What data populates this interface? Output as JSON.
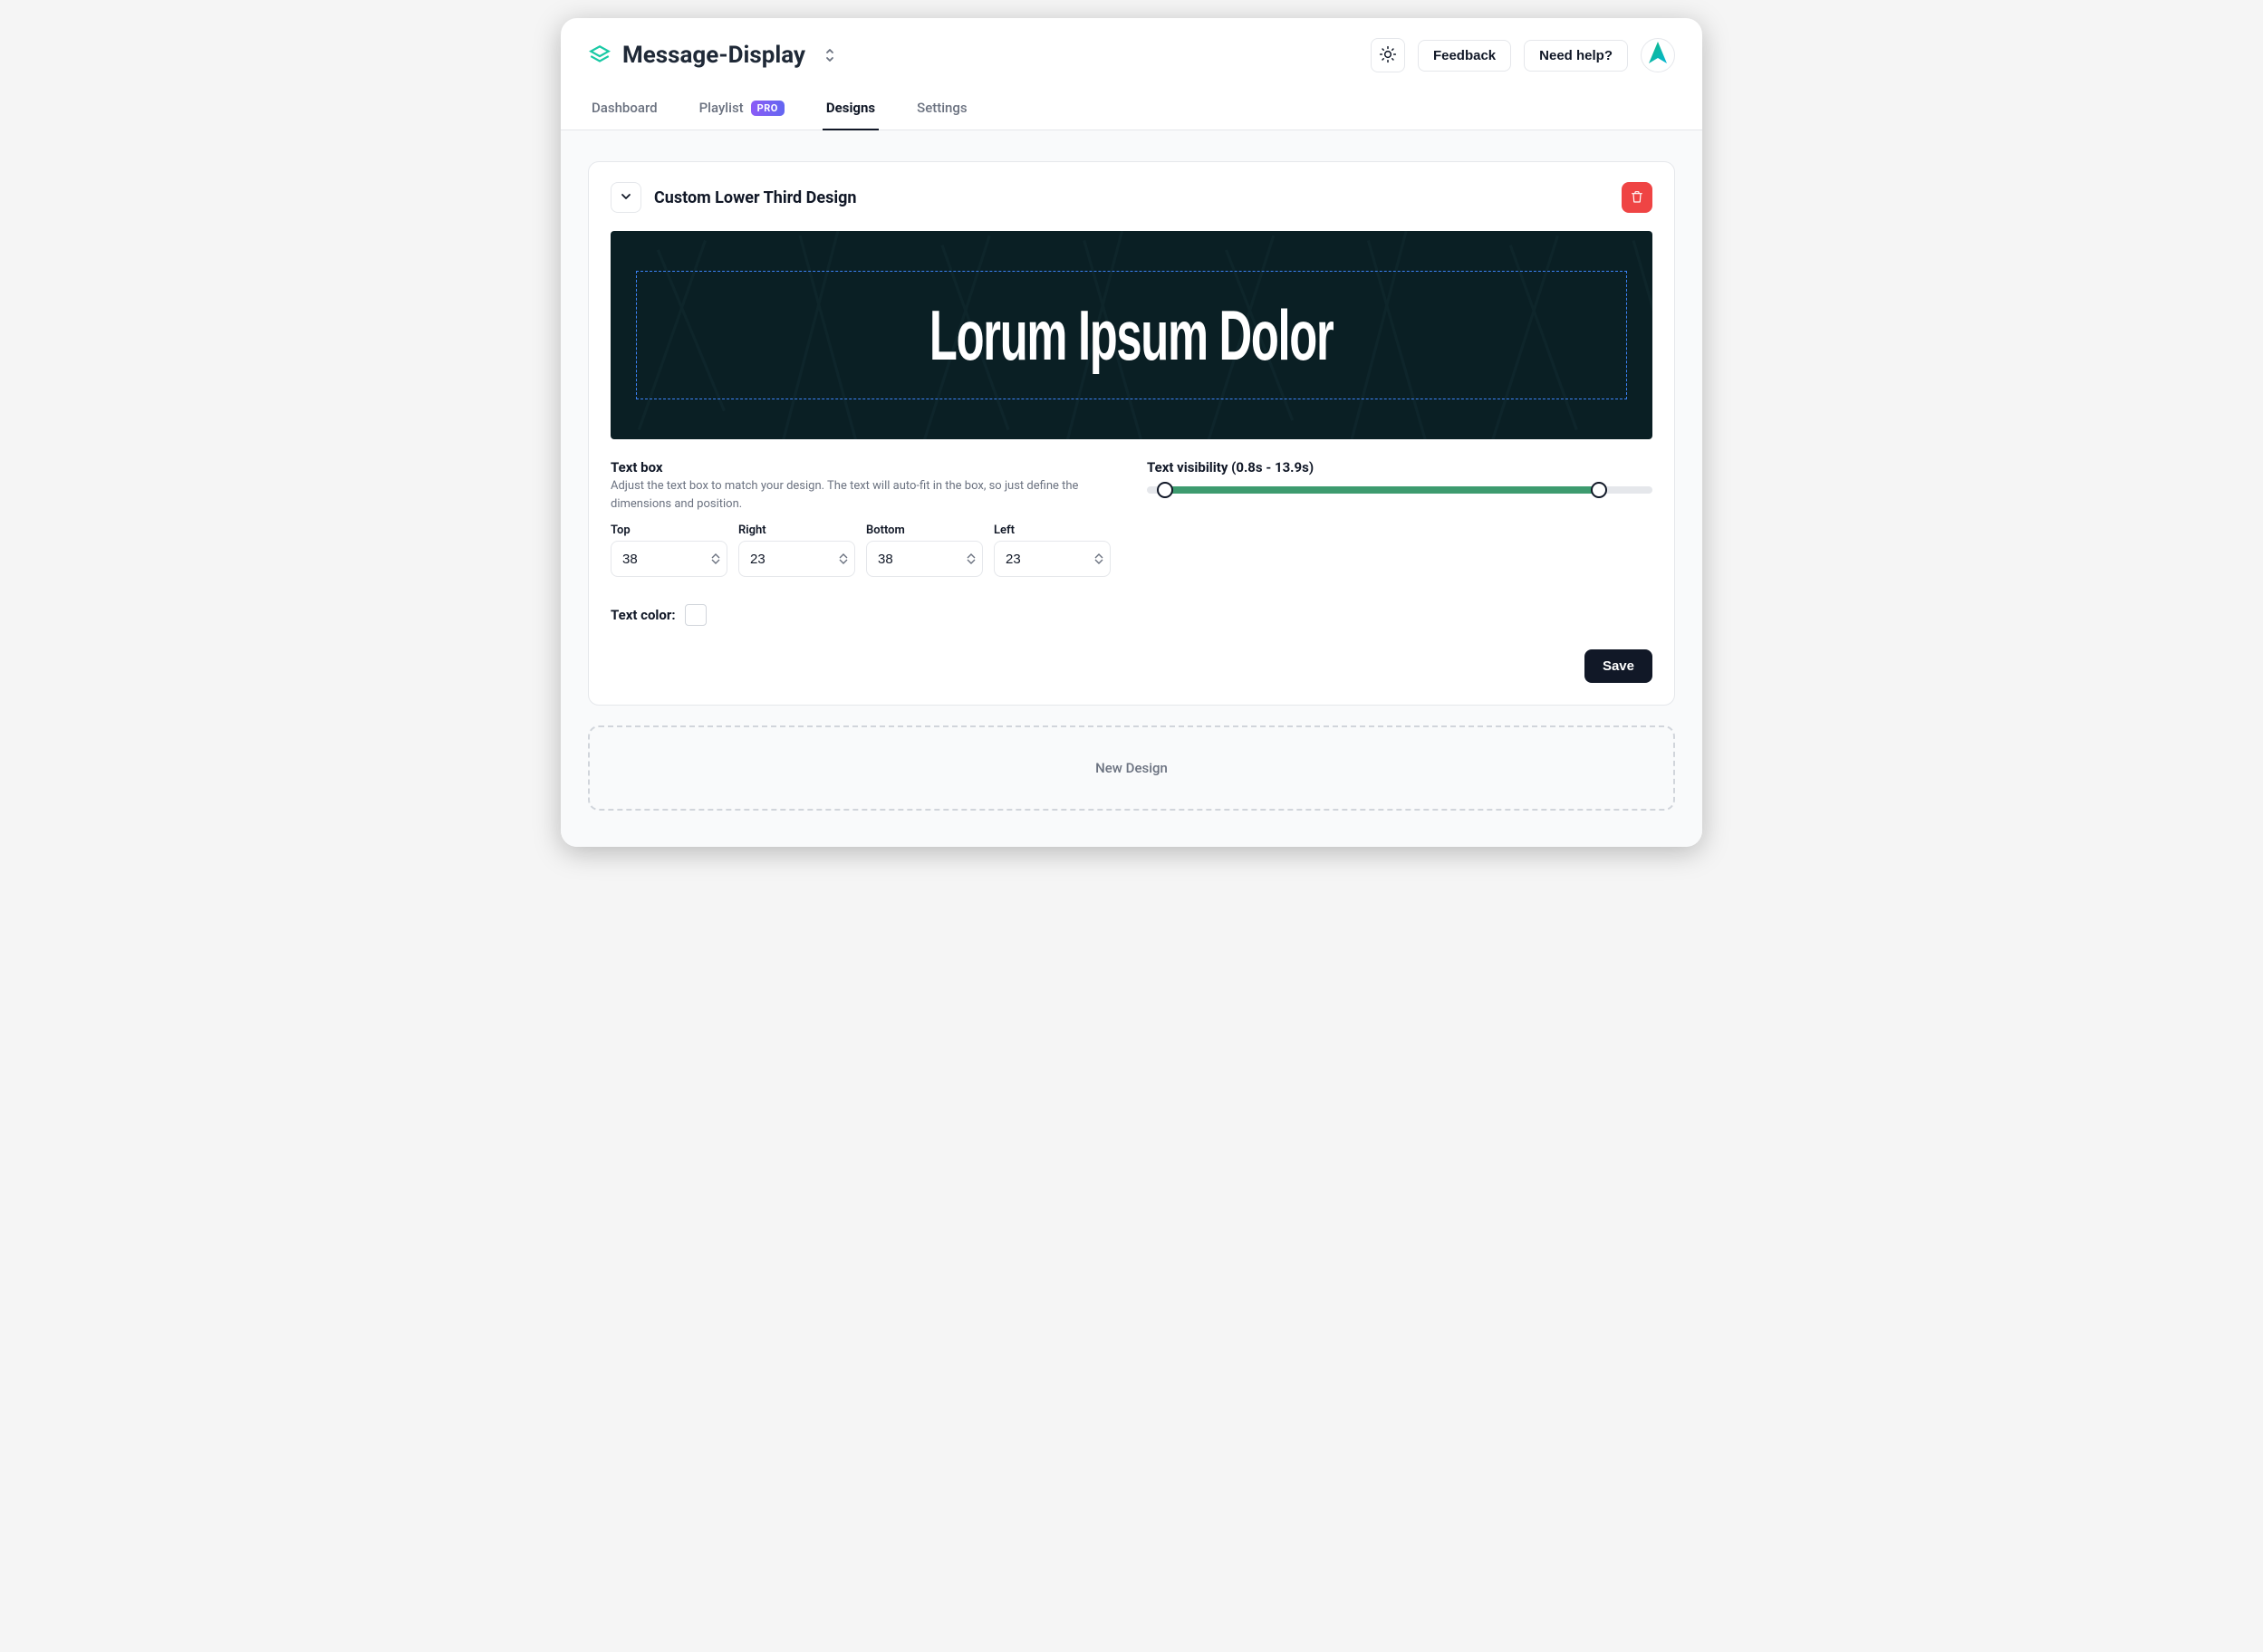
{
  "header": {
    "title": "Message-Display",
    "buttons": {
      "feedback": "Feedback",
      "need_help": "Need help?"
    }
  },
  "tabs": {
    "dashboard": "Dashboard",
    "playlist": "Playlist",
    "playlist_badge": "PRO",
    "designs": "Designs",
    "settings": "Settings"
  },
  "design": {
    "title": "Custom Lower Third Design",
    "preview_text": "Lorum Ipsum Dolor",
    "textbox_label": "Text box",
    "textbox_desc": "Adjust the text box to match your design. The text will auto-fit in the box, so just define the dimensions and position.",
    "dims": {
      "top": {
        "label": "Top",
        "value": "38"
      },
      "right": {
        "label": "Right",
        "value": "23"
      },
      "bottom": {
        "label": "Bottom",
        "value": "38"
      },
      "left": {
        "label": "Left",
        "value": "23"
      }
    },
    "text_color_label": "Text color:",
    "text_color_value": "#ffffff",
    "visibility_label": "Text visibility (0.8s - 13.9s)",
    "visibility_min": 0.8,
    "visibility_max": 13.9,
    "save_label": "Save"
  },
  "new_design_label": "New Design",
  "colors": {
    "accent": "#3d9b6f",
    "brand_teal": "#19c9a5",
    "avatar_grad_start": "#10b981",
    "avatar_grad_end": "#06b6d4"
  }
}
